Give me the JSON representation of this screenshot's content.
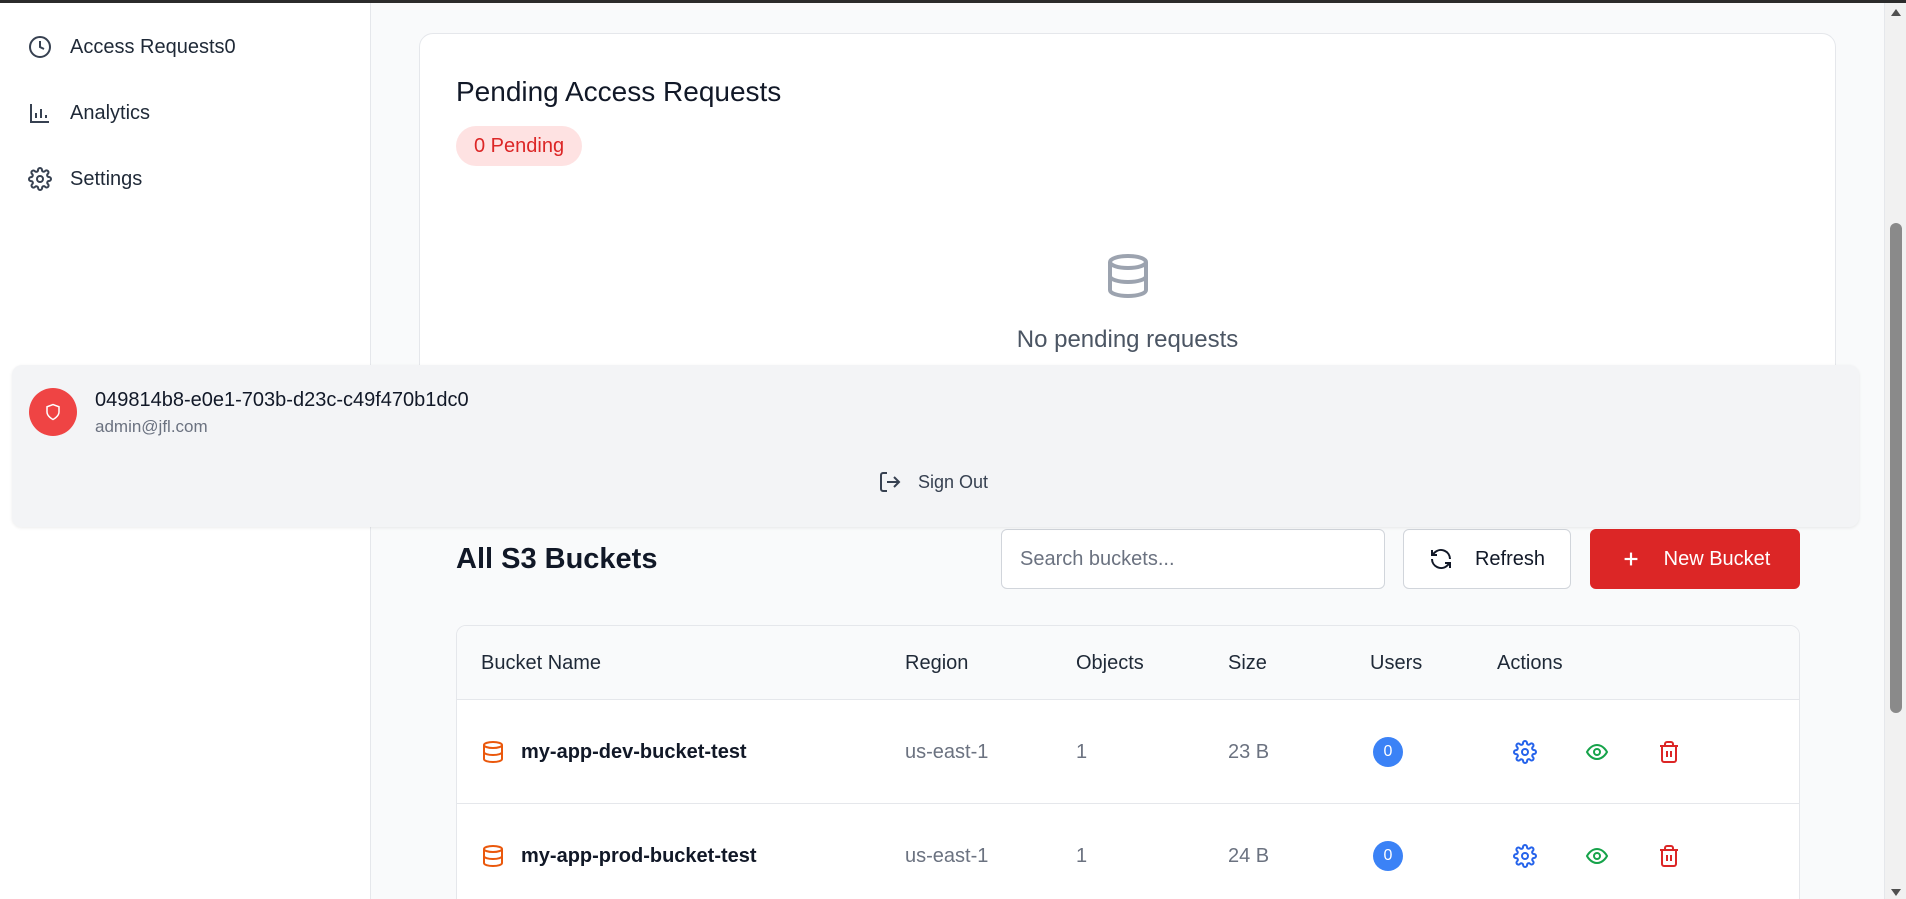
{
  "sidebar": {
    "items": [
      {
        "label": "Access Requests0",
        "icon": "clock-icon"
      },
      {
        "label": "Analytics",
        "icon": "bar-chart-icon"
      },
      {
        "label": "Settings",
        "icon": "gear-icon"
      }
    ]
  },
  "pending": {
    "title": "Pending Access Requests",
    "badge": "0 Pending",
    "empty_text": "No pending requests"
  },
  "user": {
    "id": "049814b8-e0e1-703b-d23c-c49f470b1dc0",
    "email": "admin@jfl.com",
    "sign_out": "Sign Out"
  },
  "buckets": {
    "title": "All S3 Buckets",
    "search_placeholder": "Search buckets...",
    "refresh_label": "Refresh",
    "new_label": "New Bucket",
    "columns": [
      "Bucket Name",
      "Region",
      "Objects",
      "Size",
      "Users",
      "Actions"
    ],
    "rows": [
      {
        "name": "my-app-dev-bucket-test",
        "region": "us-east-1",
        "objects": "1",
        "size": "23 B",
        "users": "0"
      },
      {
        "name": "my-app-prod-bucket-test",
        "region": "us-east-1",
        "objects": "1",
        "size": "24 B",
        "users": "0"
      }
    ]
  },
  "colors": {
    "accent_red": "#dc2626",
    "badge_bg": "#fee2e2",
    "users_badge": "#3b82f6",
    "settings_action": "#2563eb",
    "view_action": "#16a34a",
    "delete_action": "#dc2626",
    "bucket_icon": "#ea580c"
  }
}
